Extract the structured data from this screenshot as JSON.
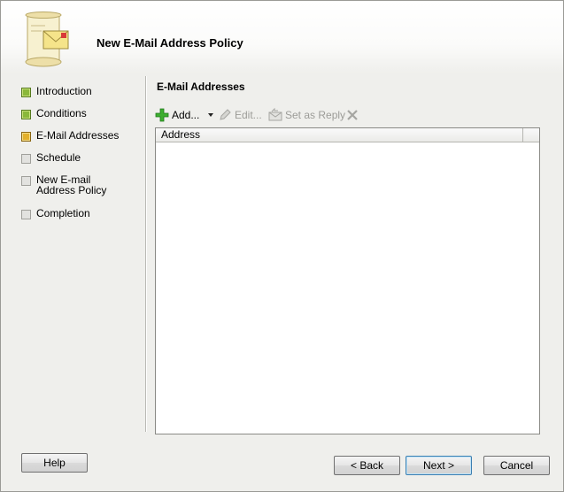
{
  "wizard": {
    "title": "New E-Mail Address Policy"
  },
  "steps": [
    {
      "label": "Introduction",
      "status": "done"
    },
    {
      "label": "Conditions",
      "status": "done"
    },
    {
      "label": "E-Mail Addresses",
      "status": "current"
    },
    {
      "label": "Schedule",
      "status": "pending"
    },
    {
      "label": "New E-mail Address Policy",
      "status": "pending"
    },
    {
      "label": "Completion",
      "status": "pending"
    }
  ],
  "section": {
    "title": "E-Mail Addresses"
  },
  "toolbar": {
    "add_label": "Add...",
    "edit_label": "Edit...",
    "set_reply_label": "Set as Reply"
  },
  "grid": {
    "columns": [
      "Address"
    ],
    "rows": []
  },
  "footer": {
    "help_label": "Help",
    "back_label": "< Back",
    "next_label": "Next >",
    "cancel_label": "Cancel"
  },
  "colors": {
    "step_done": "#8ab83a",
    "step_current": "#e3b02c",
    "step_pending": "#e2e2df",
    "add_icon": "#3cae2e"
  },
  "icons": {
    "wizard": "scroll-envelope-icon",
    "add": "green-plus-icon",
    "dropdown": "dropdown-arrow-icon",
    "edit": "pencil-icon",
    "set_reply": "envelope-reply-icon",
    "delete": "delete-x-icon"
  }
}
